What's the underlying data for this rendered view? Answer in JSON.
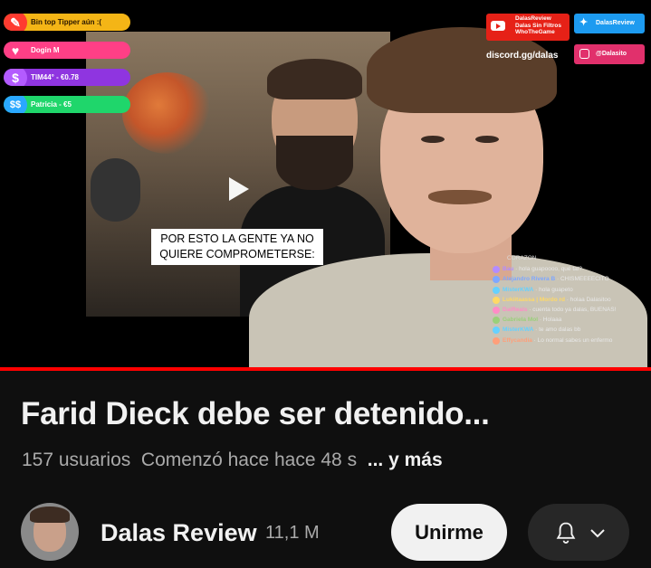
{
  "player": {
    "caption": "POR ESTO LA GENTE YA NO QUIERE COMPROMETERSE:",
    "progress": 1.0,
    "alerts": [
      {
        "text": "Bin top Tipper aún :(",
        "icon": "clapper-icon",
        "bg": "#f4b516",
        "fg": "#2b1800"
      },
      {
        "text": "Dogin M",
        "icon": "heart-icon",
        "bg": "#ff3f86",
        "fg": "#ffffff"
      },
      {
        "text": "TIM44° - €0.78",
        "icon": "dollar-icon",
        "bg": "#8f35e0",
        "fg": "#ffffff"
      },
      {
        "text": "Patricia - €5",
        "icon": "money-icon",
        "bg": "#1fd66b",
        "fg": "#ffffff"
      }
    ],
    "social": {
      "yt_lines": [
        "DalasReview",
        "Dalas Sin Filtros",
        "WhoTheGame"
      ],
      "twitter": "DalasReview",
      "discord": "discord.gg/dalas",
      "instagram": "@Dalasito"
    },
    "chat_header": "CORAZON",
    "chat": [
      {
        "user": "Bau",
        "msg": "hola guapoooo, qué tal?",
        "color": "#b38cff"
      },
      {
        "user": "Alejandro Rivera B",
        "msg": "CHISMEEEECITO",
        "color": "#7fa7ff"
      },
      {
        "user": "MisterKWA",
        "msg": "hola guapeto",
        "color": "#66d1ff"
      },
      {
        "user": "Lukiitaassa | Mordo rd",
        "msg": "holaa Dalasitoo",
        "color": "#ffd966"
      },
      {
        "user": "DaiReals",
        "msg": "cuenta todo ya dalas, BUENAS!",
        "color": "#ff8cc6"
      },
      {
        "user": "Gabriela Mol",
        "msg": "Holaaa",
        "color": "#9ad07a"
      },
      {
        "user": "MisterKWA",
        "msg": "te amo dalas bb",
        "color": "#66d1ff"
      },
      {
        "user": "Effycandia",
        "msg": "Lo normal sabes un enfermo",
        "color": "#ff9f7a"
      }
    ]
  },
  "video": {
    "title": "Farid Dieck debe ser detenido...",
    "viewers": "157 usuarios",
    "started": "Comenzó hace hace 48 s",
    "more": "... y más"
  },
  "channel": {
    "name": "Dalas Review",
    "subscribers": "11,1 M",
    "join_label": "Unirme"
  }
}
